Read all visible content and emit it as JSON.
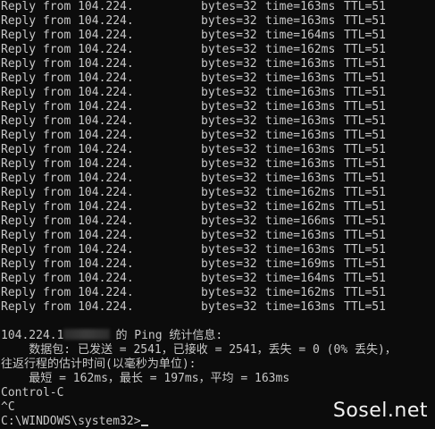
{
  "ping_replies": [
    {
      "reply": "Reply from 104.224.",
      "bytes": "bytes=32",
      "time": "time=163ms",
      "ttl": "TTL=51"
    },
    {
      "reply": "Reply from 104.224.",
      "bytes": "bytes=32",
      "time": "time=163ms",
      "ttl": "TTL=51"
    },
    {
      "reply": "Reply from 104.224.",
      "bytes": "bytes=32",
      "time": "time=164ms",
      "ttl": "TTL=51"
    },
    {
      "reply": "Reply from 104.224.",
      "bytes": "bytes=32",
      "time": "time=162ms",
      "ttl": "TTL=51"
    },
    {
      "reply": "Reply from 104.224.",
      "bytes": "bytes=32",
      "time": "time=163ms",
      "ttl": "TTL=51"
    },
    {
      "reply": "Reply from 104.224.",
      "bytes": "bytes=32",
      "time": "time=163ms",
      "ttl": "TTL=51"
    },
    {
      "reply": "Reply from 104.224.",
      "bytes": "bytes=32",
      "time": "time=163ms",
      "ttl": "TTL=51"
    },
    {
      "reply": "Reply from 104.224.",
      "bytes": "bytes=32",
      "time": "time=163ms",
      "ttl": "TTL=51"
    },
    {
      "reply": "Reply from 104.224.",
      "bytes": "bytes=32",
      "time": "time=163ms",
      "ttl": "TTL=51"
    },
    {
      "reply": "Reply from 104.224.",
      "bytes": "bytes=32",
      "time": "time=163ms",
      "ttl": "TTL=51"
    },
    {
      "reply": "Reply from 104.224.",
      "bytes": "bytes=32",
      "time": "time=163ms",
      "ttl": "TTL=51"
    },
    {
      "reply": "Reply from 104.224.",
      "bytes": "bytes=32",
      "time": "time=163ms",
      "ttl": "TTL=51"
    },
    {
      "reply": "Reply from 104.224.",
      "bytes": "bytes=32",
      "time": "time=163ms",
      "ttl": "TTL=51"
    },
    {
      "reply": "Reply from 104.224.",
      "bytes": "bytes=32",
      "time": "time=162ms",
      "ttl": "TTL=51"
    },
    {
      "reply": "Reply from 104.224.",
      "bytes": "bytes=32",
      "time": "time=162ms",
      "ttl": "TTL=51"
    },
    {
      "reply": "Reply from 104.224.",
      "bytes": "bytes=32",
      "time": "time=166ms",
      "ttl": "TTL=51"
    },
    {
      "reply": "Reply from 104.224.",
      "bytes": "bytes=32",
      "time": "time=163ms",
      "ttl": "TTL=51"
    },
    {
      "reply": "Reply from 104.224.",
      "bytes": "bytes=32",
      "time": "time=163ms",
      "ttl": "TTL=51"
    },
    {
      "reply": "Reply from 104.224.",
      "bytes": "bytes=32",
      "time": "time=169ms",
      "ttl": "TTL=51"
    },
    {
      "reply": "Reply from 104.224.",
      "bytes": "bytes=32",
      "time": "time=164ms",
      "ttl": "TTL=51"
    },
    {
      "reply": "Reply from 104.224.",
      "bytes": "bytes=32",
      "time": "time=162ms",
      "ttl": "TTL=51"
    },
    {
      "reply": "Reply from 104.224.",
      "bytes": "bytes=32",
      "time": "time=163ms",
      "ttl": "TTL=51"
    }
  ],
  "stats": {
    "header_ip": "104.224.1",
    "header_suffix": "的 Ping 统计信息:",
    "packets_line": "    数据包: 已发送 = 2541，已接收 = 2541，丢失 = 0 (0% 丢失)，",
    "estimate_line": "往返行程的估计时间(以毫秒为单位):",
    "rtt_line": "    最短 = 162ms，最长 = 197ms，平均 = 163ms"
  },
  "interrupt": {
    "label": "Control-C",
    "caret": "^C"
  },
  "prompt": {
    "path": "C:\\WINDOWS\\system32>"
  },
  "watermark": {
    "text": "Sosel.net"
  },
  "colors": {
    "background": "#0c0c0c",
    "foreground": "#c8c8c8"
  }
}
